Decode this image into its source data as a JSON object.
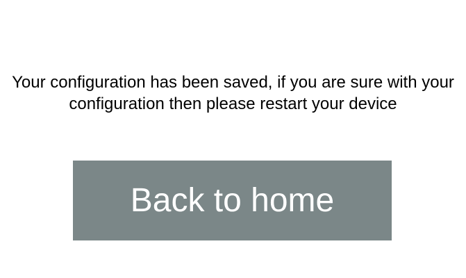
{
  "message": {
    "text": "Your configuration has been saved, if you are sure with your configuration then please restart your device"
  },
  "button": {
    "label": "Back to home",
    "background": "#7b8788",
    "text_color": "#ffffff"
  }
}
